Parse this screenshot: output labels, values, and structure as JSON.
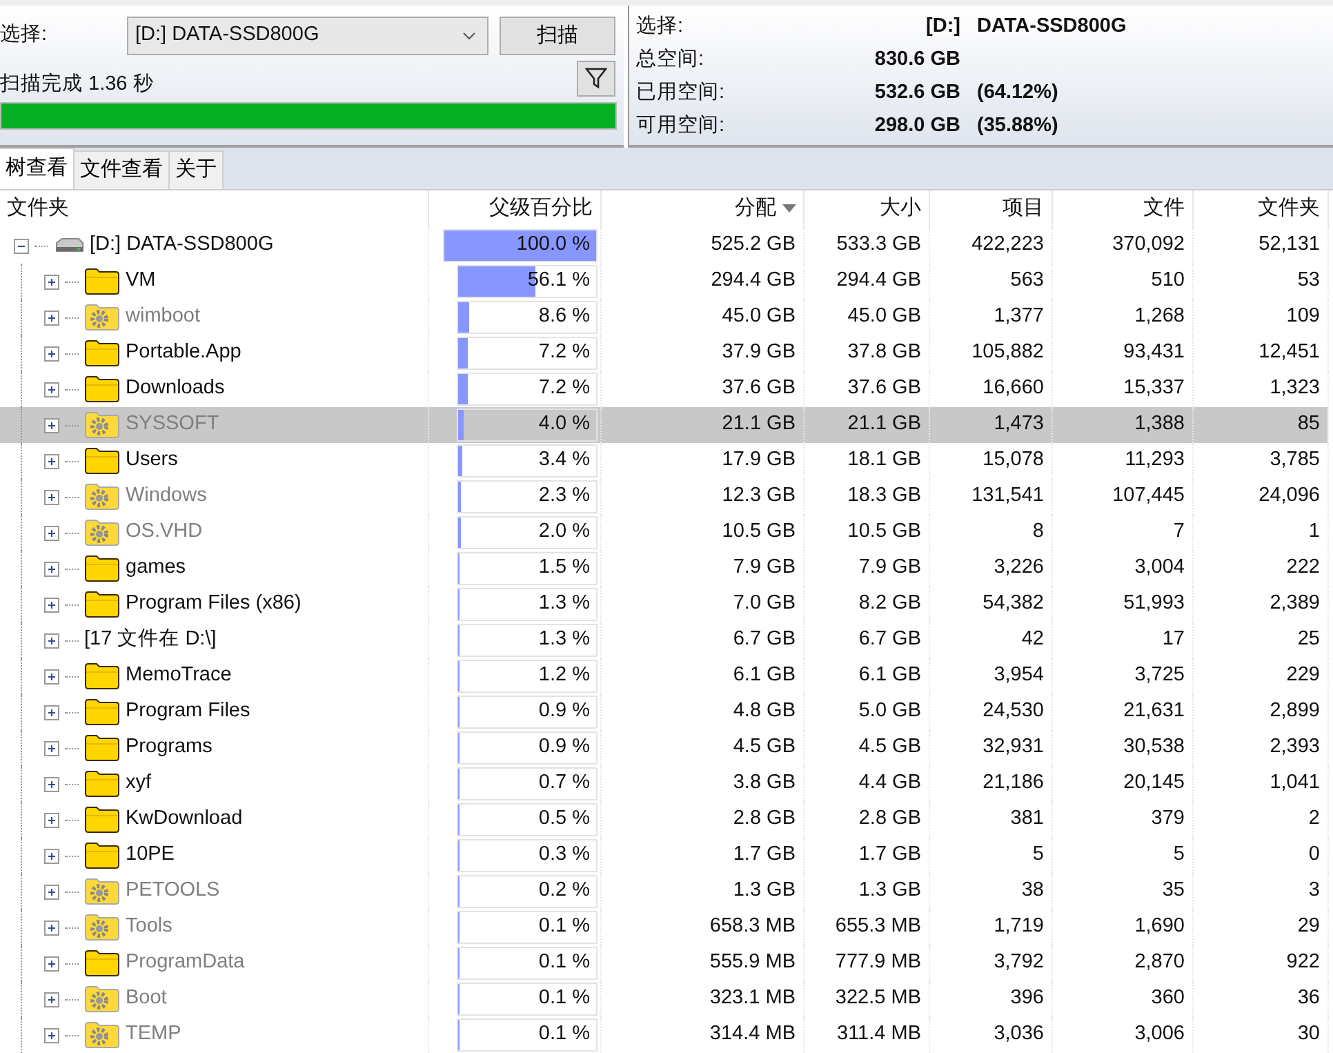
{
  "scan_panel": {
    "select_label": "选择:",
    "drive_select": {
      "value": "[D:] DATA-SSD800G"
    },
    "scan_button": "扫描",
    "status": "扫描完成 1.36 秒",
    "progress": {
      "level": 1.0
    }
  },
  "info_panel": {
    "rows": [
      {
        "label": "选择:",
        "value": "[D:]",
        "extra": "DATA-SSD800G"
      },
      {
        "label": "总空间:",
        "value": "830.6 GB"
      },
      {
        "label": "已用空间:",
        "value": "532.6 GB",
        "extra": "(64.12%)"
      },
      {
        "label": "可用空间:",
        "value": "298.0 GB",
        "extra": "(35.88%)"
      }
    ]
  },
  "tabs": [
    {
      "label": "树查看",
      "selected": true
    },
    {
      "label": "文件查看",
      "selected": false
    },
    {
      "label": "关于",
      "selected": false
    }
  ],
  "table": {
    "columns": [
      {
        "label": "文件夹",
        "sorted": false
      },
      {
        "label": "父级百分比",
        "sorted": false
      },
      {
        "label": "分配",
        "sorted": true
      },
      {
        "label": "大小",
        "sorted": false
      },
      {
        "label": "项目",
        "sorted": false
      },
      {
        "label": "文件",
        "sorted": false
      },
      {
        "label": "文件夹",
        "sorted": false
      }
    ],
    "rows": [
      {
        "kind": "drive",
        "name": "[D:] DATA-SSD800G",
        "expanded": true,
        "hidden": false,
        "selected": false,
        "level": 1.0,
        "percent": "100.0 %",
        "allocated": "525.2 GB",
        "size": "533.3 GB",
        "items": "422,223",
        "files": "370,092",
        "folders": "52,131",
        "children": [
          {
            "kind": "folder",
            "name": "VM",
            "expanded": false,
            "hidden": false,
            "selected": false,
            "level": 0.561,
            "percent": "56.1 %",
            "allocated": "294.4 GB",
            "size": "294.4 GB",
            "items": "563",
            "files": "510",
            "folders": "53"
          },
          {
            "kind": "system",
            "name": "wimboot",
            "expanded": false,
            "hidden": true,
            "selected": false,
            "level": 0.086,
            "percent": "8.6 %",
            "allocated": "45.0 GB",
            "size": "45.0 GB",
            "items": "1,377",
            "files": "1,268",
            "folders": "109"
          },
          {
            "kind": "folder",
            "name": "Portable.App",
            "expanded": false,
            "hidden": false,
            "selected": false,
            "level": 0.072,
            "percent": "7.2 %",
            "allocated": "37.9 GB",
            "size": "37.8 GB",
            "items": "105,882",
            "files": "93,431",
            "folders": "12,451"
          },
          {
            "kind": "folder",
            "name": "Downloads",
            "expanded": false,
            "hidden": false,
            "selected": false,
            "level": 0.072,
            "percent": "7.2 %",
            "allocated": "37.6 GB",
            "size": "37.6 GB",
            "items": "16,660",
            "files": "15,337",
            "folders": "1,323"
          },
          {
            "kind": "system",
            "name": "SYSSOFT",
            "expanded": false,
            "hidden": true,
            "selected": true,
            "level": 0.04,
            "percent": "4.0 %",
            "allocated": "21.1 GB",
            "size": "21.1 GB",
            "items": "1,473",
            "files": "1,388",
            "folders": "85"
          },
          {
            "kind": "folder",
            "name": "Users",
            "expanded": false,
            "hidden": false,
            "selected": false,
            "level": 0.034,
            "percent": "3.4 %",
            "allocated": "17.9 GB",
            "size": "18.1 GB",
            "items": "15,078",
            "files": "11,293",
            "folders": "3,785"
          },
          {
            "kind": "system",
            "name": "Windows",
            "expanded": false,
            "hidden": true,
            "selected": false,
            "level": 0.023,
            "percent": "2.3 %",
            "allocated": "12.3 GB",
            "size": "18.3 GB",
            "items": "131,541",
            "files": "107,445",
            "folders": "24,096"
          },
          {
            "kind": "system",
            "name": "OS.VHD",
            "expanded": false,
            "hidden": true,
            "selected": false,
            "level": 0.02,
            "percent": "2.0 %",
            "allocated": "10.5 GB",
            "size": "10.5 GB",
            "items": "8",
            "files": "7",
            "folders": "1"
          },
          {
            "kind": "folder",
            "name": "games",
            "expanded": false,
            "hidden": false,
            "selected": false,
            "level": 0.015,
            "percent": "1.5 %",
            "allocated": "7.9 GB",
            "size": "7.9 GB",
            "items": "3,226",
            "files": "3,004",
            "folders": "222"
          },
          {
            "kind": "folder",
            "name": "Program Files (x86)",
            "expanded": false,
            "hidden": false,
            "selected": false,
            "level": 0.013,
            "percent": "1.3 %",
            "allocated": "7.0 GB",
            "size": "8.2 GB",
            "items": "54,382",
            "files": "51,993",
            "folders": "2,389"
          },
          {
            "kind": "files",
            "name": "[17 文件在 D:\\]",
            "expanded": false,
            "hidden": false,
            "selected": false,
            "level": 0.013,
            "percent": "1.3 %",
            "allocated": "6.7 GB",
            "size": "6.7 GB",
            "items": "42",
            "files": "17",
            "folders": "25"
          },
          {
            "kind": "folder",
            "name": "MemoTrace",
            "expanded": false,
            "hidden": false,
            "selected": false,
            "level": 0.012,
            "percent": "1.2 %",
            "allocated": "6.1 GB",
            "size": "6.1 GB",
            "items": "3,954",
            "files": "3,725",
            "folders": "229"
          },
          {
            "kind": "folder",
            "name": "Program Files",
            "expanded": false,
            "hidden": false,
            "selected": false,
            "level": 0.009,
            "percent": "0.9 %",
            "allocated": "4.8 GB",
            "size": "5.0 GB",
            "items": "24,530",
            "files": "21,631",
            "folders": "2,899"
          },
          {
            "kind": "folder",
            "name": "Programs",
            "expanded": false,
            "hidden": false,
            "selected": false,
            "level": 0.009,
            "percent": "0.9 %",
            "allocated": "4.5 GB",
            "size": "4.5 GB",
            "items": "32,931",
            "files": "30,538",
            "folders": "2,393"
          },
          {
            "kind": "folder",
            "name": "xyf",
            "expanded": false,
            "hidden": false,
            "selected": false,
            "level": 0.007,
            "percent": "0.7 %",
            "allocated": "3.8 GB",
            "size": "4.4 GB",
            "items": "21,186",
            "files": "20,145",
            "folders": "1,041"
          },
          {
            "kind": "folder",
            "name": "KwDownload",
            "expanded": false,
            "hidden": false,
            "selected": false,
            "level": 0.005,
            "percent": "0.5 %",
            "allocated": "2.8 GB",
            "size": "2.8 GB",
            "items": "381",
            "files": "379",
            "folders": "2"
          },
          {
            "kind": "folder",
            "name": "10PE",
            "expanded": false,
            "hidden": false,
            "selected": false,
            "level": 0.003,
            "percent": "0.3 %",
            "allocated": "1.7 GB",
            "size": "1.7 GB",
            "items": "5",
            "files": "5",
            "folders": "0"
          },
          {
            "kind": "system",
            "name": "PETOOLS",
            "expanded": false,
            "hidden": true,
            "selected": false,
            "level": 0.002,
            "percent": "0.2 %",
            "allocated": "1.3 GB",
            "size": "1.3 GB",
            "items": "38",
            "files": "35",
            "folders": "3"
          },
          {
            "kind": "system",
            "name": "Tools",
            "expanded": false,
            "hidden": true,
            "selected": false,
            "level": 0.001,
            "percent": "0.1 %",
            "allocated": "658.3 MB",
            "size": "655.3 MB",
            "items": "1,719",
            "files": "1,690",
            "folders": "29"
          },
          {
            "kind": "folder",
            "name": "ProgramData",
            "expanded": false,
            "hidden": true,
            "selected": false,
            "level": 0.001,
            "percent": "0.1 %",
            "allocated": "555.9 MB",
            "size": "777.9 MB",
            "items": "3,792",
            "files": "2,870",
            "folders": "922"
          },
          {
            "kind": "system",
            "name": "Boot",
            "expanded": false,
            "hidden": true,
            "selected": false,
            "level": 0.001,
            "percent": "0.1 %",
            "allocated": "323.1 MB",
            "size": "322.5 MB",
            "items": "396",
            "files": "360",
            "folders": "36"
          },
          {
            "kind": "system",
            "name": "TEMP",
            "expanded": false,
            "hidden": true,
            "selected": false,
            "level": 0.001,
            "percent": "0.1 %",
            "allocated": "314.4 MB",
            "size": "311.4 MB",
            "items": "3,036",
            "files": "3,006",
            "folders": "30"
          }
        ]
      }
    ]
  }
}
